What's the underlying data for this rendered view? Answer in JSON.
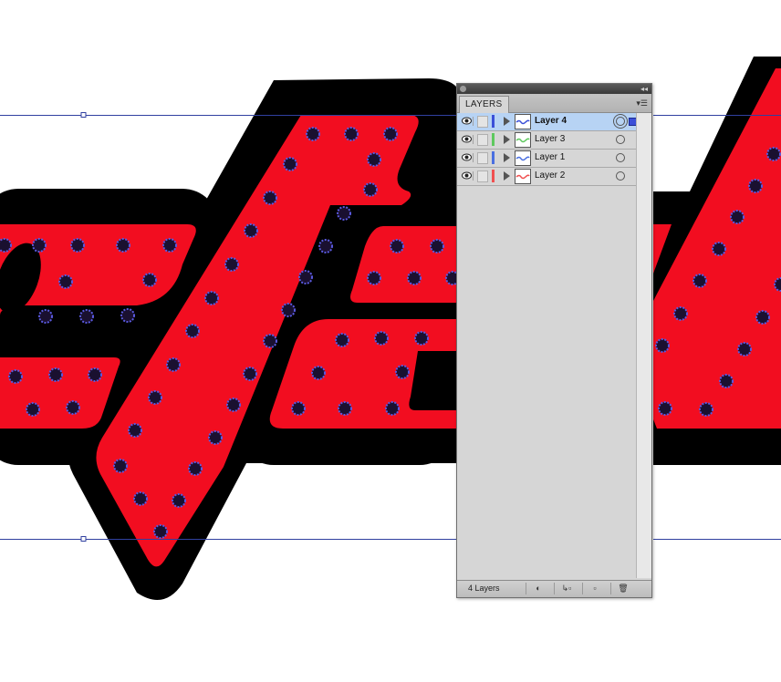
{
  "panel": {
    "tab_label": "LAYERS",
    "layer_count_label": "4 Layers",
    "layers": [
      {
        "name": "Layer 4",
        "color": "#3b4fd8",
        "selected": true
      },
      {
        "name": "Layer 3",
        "color": "#5ec95e",
        "selected": false
      },
      {
        "name": "Layer 1",
        "color": "#4a6fe0",
        "selected": false
      },
      {
        "name": "Layer 2",
        "color": "#f05050",
        "selected": false
      }
    ],
    "footer_icons": [
      "make-clipping-mask-icon",
      "create-sublayer-icon",
      "new-layer-icon",
      "delete-layer-icon"
    ]
  },
  "artwork": {
    "fill_color": "#f20d20",
    "outline_color": "#000000",
    "dot_color": "#1a1030",
    "dot_ring_color": "#5a5ae0",
    "guide_color": "#3040a0"
  }
}
